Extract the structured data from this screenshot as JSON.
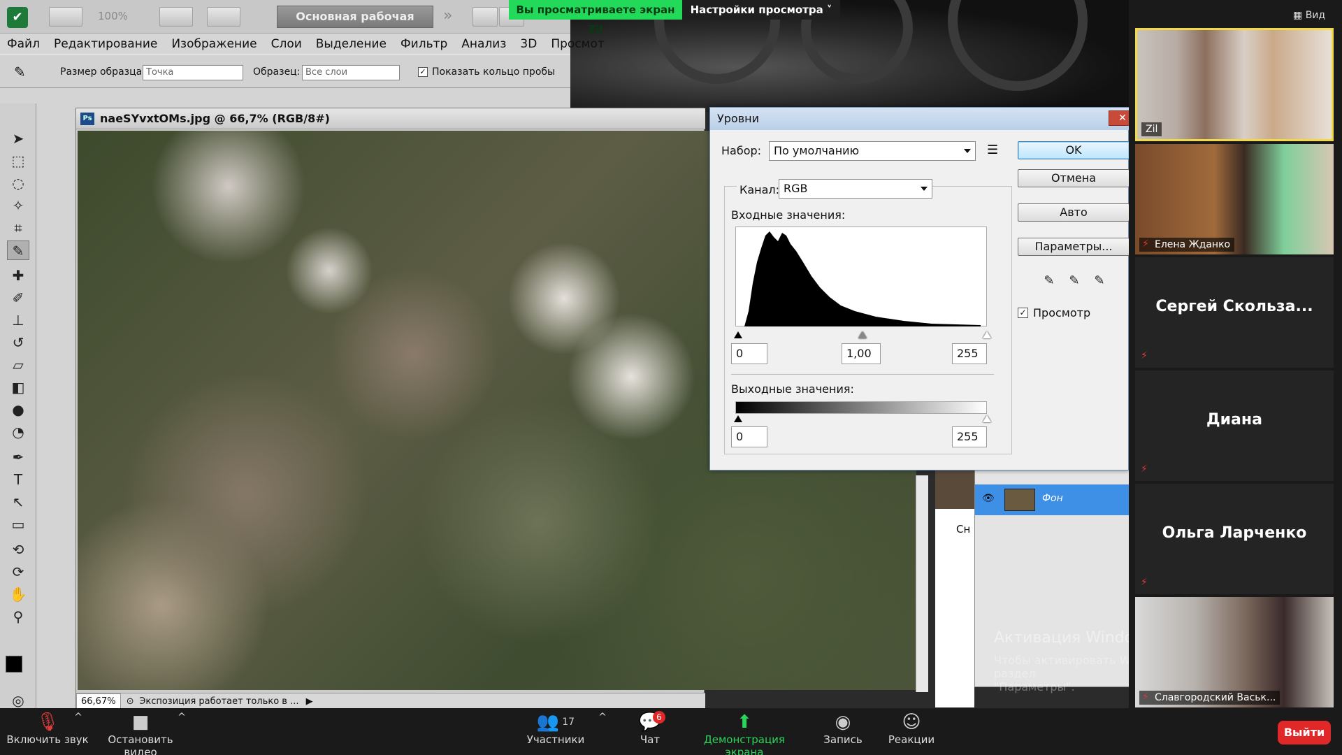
{
  "banner": {
    "viewing": "Вы просматриваете экран Zil",
    "view_options": "Настройки просмотра ˅"
  },
  "ps": {
    "zoom_combo": "100%",
    "workspace": "Основная рабочая среда",
    "menu": [
      "Файл",
      "Редактирование",
      "Изображение",
      "Слои",
      "Выделение",
      "Фильтр",
      "Анализ",
      "3D",
      "Просмот"
    ],
    "options": {
      "sample_size_label": "Размер образца:",
      "sample_size_value": "Точка",
      "sample_label": "Образец:",
      "sample_value": "Все слои",
      "show_ring": "Показать кольцо пробы"
    },
    "doc_title": "naeSYvxtOMs.jpg @ 66,7% (RGB/8#)",
    "doc_zoom": "66,67%",
    "doc_status": "Экспозиция работает только в ...",
    "layer_name": "Фон",
    "side_label": "Сн"
  },
  "levels": {
    "title": "Уровни",
    "preset_label": "Набор:",
    "preset_value": "По умолчанию",
    "channel_label": "Канал:",
    "channel_value": "RGB",
    "input_label": "Входные значения:",
    "input_values": [
      "0",
      "1,00",
      "255"
    ],
    "output_label": "Выходные значения:",
    "output_values": [
      "0",
      "255"
    ],
    "ok": "OK",
    "cancel": "Отмена",
    "auto": "Авто",
    "options": "Параметры...",
    "preview": "Просмотр"
  },
  "watermark": {
    "line1": "Активация Windows",
    "line2": "Чтобы активировать Windows, перейдите в раздел",
    "line3": "\"Параметры\"."
  },
  "gallery": {
    "view_button": "Вид",
    "tiles": [
      {
        "name": "Zil"
      },
      {
        "name": "Елена Жданко"
      },
      {
        "name": "Сергей  Скольза..."
      },
      {
        "name": "Диана"
      },
      {
        "name": "Ольга Ларченко"
      },
      {
        "name": "Славгородский Васьк..."
      }
    ]
  },
  "zoom_toolbar": {
    "unmute": "Включить звук",
    "start_video": "Остановить видео",
    "participants": "Участники",
    "participants_count": "17",
    "chat": "Чат",
    "chat_badge": "6",
    "share": "Демонстрация экрана",
    "record": "Запись",
    "reactions": "Реакции",
    "leave": "Выйти"
  }
}
